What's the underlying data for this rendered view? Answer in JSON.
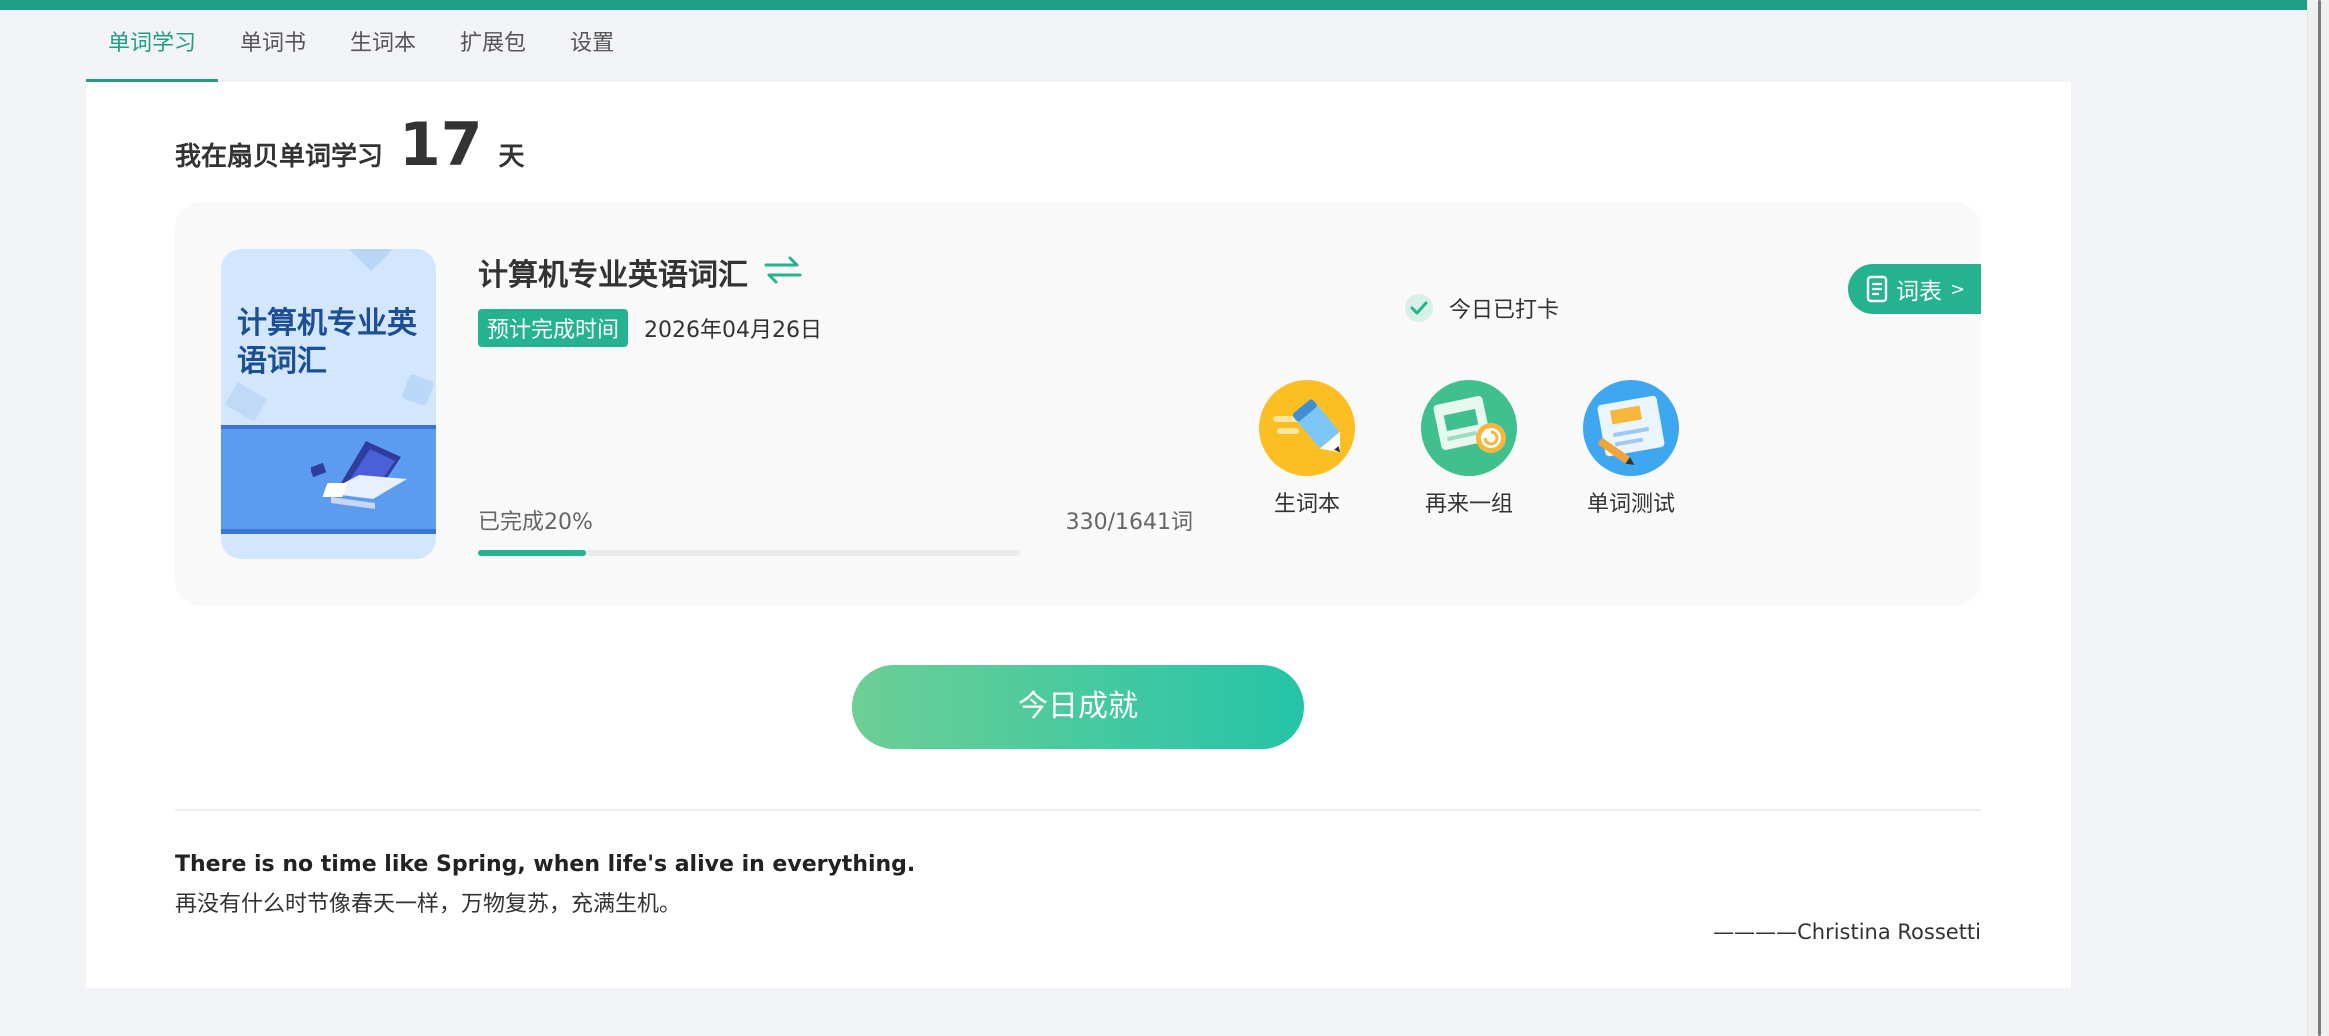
{
  "tabs": [
    {
      "label": "单词学习",
      "active": true
    },
    {
      "label": "单词书",
      "active": false
    },
    {
      "label": "生词本",
      "active": false
    },
    {
      "label": "扩展包",
      "active": false
    },
    {
      "label": "设置",
      "active": false
    }
  ],
  "streak": {
    "prefix": "我在扇贝单词学习",
    "days": "17",
    "suffix": "天"
  },
  "book": {
    "cover_title": "计算机专业英语词汇",
    "name": "计算机专业英语词汇",
    "eta_badge": "预计完成时间",
    "eta_date": "2026年04月26日",
    "progress_label": "已完成20%",
    "progress_count": "330/1641词",
    "progress_fraction": 0.2,
    "switch_icon": "switch-arrows-icon"
  },
  "checkin": {
    "label": "今日已打卡",
    "icon": "check-icon"
  },
  "wordlist_button": {
    "label": "词表",
    "arrow": ">",
    "icon": "document-icon"
  },
  "actions": [
    {
      "label": "生词本",
      "icon": "pen-icon"
    },
    {
      "label": "再来一组",
      "icon": "refresh-card-icon"
    },
    {
      "label": "单词测试",
      "icon": "test-paper-icon"
    }
  ],
  "cta": {
    "label": "今日成就"
  },
  "quote": {
    "en": "There is no time like Spring, when life's alive in everything.",
    "zh": "再没有什么时节像春天一样，万物复苏，充满生机。",
    "author": "————Christina Rossetti"
  },
  "colors": {
    "brand": "#209e85",
    "accent": "#25b38f",
    "yellow": "#fbbf24",
    "blue": "#3ea7f2"
  }
}
